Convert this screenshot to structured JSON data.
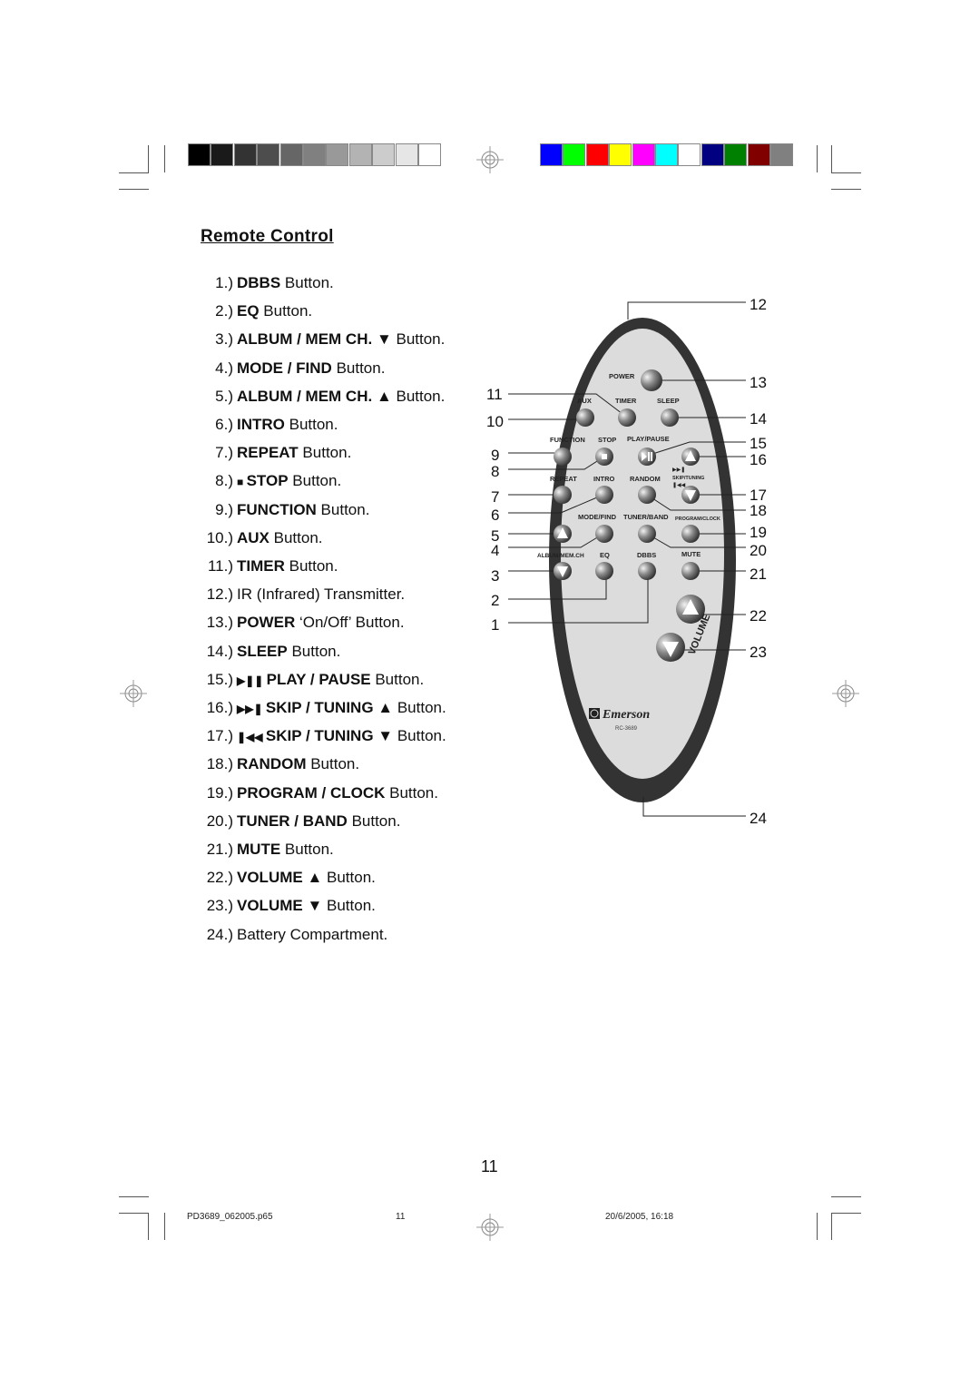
{
  "print_marks": {
    "grayscale_bar": [
      "#000000",
      "#1a1a1a",
      "#333333",
      "#4d4d4d",
      "#666666",
      "#808080",
      "#999999",
      "#b3b3b3",
      "#cccccc",
      "#e6e6e6",
      "#ffffff"
    ],
    "color_bar": [
      "#0000ff",
      "#00ff00",
      "#ff0000",
      "#ffff00",
      "#ff00ff",
      "#00ffff",
      "#ffffff",
      "#000080",
      "#008000",
      "#800000",
      "#808080"
    ]
  },
  "section_title": "Remote Control",
  "items": [
    {
      "n": "1.)",
      "icon": "",
      "bold": "DBBS",
      "rest": " Button."
    },
    {
      "n": "2.)",
      "icon": "",
      "bold": "EQ",
      "rest": " Button."
    },
    {
      "n": "3.)",
      "icon": "",
      "bold": "ALBUM / MEM CH.",
      "rest": " ▼ Button."
    },
    {
      "n": "4.)",
      "icon": "",
      "bold": "MODE / FIND",
      "rest": " Button."
    },
    {
      "n": "5.)",
      "icon": "",
      "bold": "ALBUM / MEM CH.",
      "rest": " ▲ Button."
    },
    {
      "n": "6.)",
      "icon": "",
      "bold": "INTRO",
      "rest": " Button."
    },
    {
      "n": "7.)",
      "icon": "",
      "bold": "REPEAT",
      "rest": " Button."
    },
    {
      "n": "8.)",
      "icon": "■ ",
      "bold": "STOP",
      "rest": " Button."
    },
    {
      "n": "9.)",
      "icon": "",
      "bold": "FUNCTION",
      "rest": " Button."
    },
    {
      "n": "10.)",
      "icon": "",
      "bold": "AUX",
      "rest": " Button."
    },
    {
      "n": "11.)",
      "icon": "",
      "bold": "TIMER",
      "rest": " Button."
    },
    {
      "n": "12.)",
      "icon": "",
      "bold": "",
      "rest": "IR (Infrared) Transmitter."
    },
    {
      "n": "13.)",
      "icon": "",
      "bold": "POWER",
      "rest": " ‘On/Off’ Button."
    },
    {
      "n": "14.)",
      "icon": "",
      "bold": "SLEEP",
      "rest": " Button."
    },
    {
      "n": "15.)",
      "icon": "▶❚❚ ",
      "bold": "PLAY / PAUSE",
      "rest": " Button."
    },
    {
      "n": "16.)",
      "icon": "▶▶❚ ",
      "bold": "SKIP / TUNING",
      "rest": " ▲ Button."
    },
    {
      "n": "17.)",
      "icon": "❚◀◀ ",
      "bold": "SKIP / TUNING",
      "rest": " ▼ Button."
    },
    {
      "n": "18.)",
      "icon": "",
      "bold": "RANDOM",
      "rest": " Button."
    },
    {
      "n": "19.)",
      "icon": "",
      "bold": "PROGRAM / CLOCK",
      "rest": " Button."
    },
    {
      "n": "20.)",
      "icon": "",
      "bold": "TUNER / BAND",
      "rest": " Button."
    },
    {
      "n": "21.)",
      "icon": "",
      "bold": "MUTE",
      "rest": " Button."
    },
    {
      "n": "22.)",
      "icon": "",
      "bold": "VOLUME",
      "rest": " ▲ Button."
    },
    {
      "n": "23.)",
      "icon": "",
      "bold": "VOLUME",
      "rest": " ▼ Button."
    },
    {
      "n": "24.)",
      "icon": "",
      "bold": "",
      "rest": "Battery Compartment."
    }
  ],
  "remote": {
    "labels": {
      "power": "POWER",
      "aux": "AUX",
      "timer": "TIMER",
      "sleep": "SLEEP",
      "function": "FUNCTION",
      "stop": "STOP",
      "play_pause": "PLAY/PAUSE",
      "repeat": "REPEAT",
      "intro": "INTRO",
      "random": "RANDOM",
      "skip_tuning": "SKIP/TUNING",
      "mode_find": "MODE/FIND",
      "tuner_band": "TUNER/BAND",
      "program_clock": "PROGRAM/CLOCK",
      "album_mem": "ALBUM/MEM.CH",
      "eq": "EQ",
      "dbbs": "DBBS",
      "mute": "MUTE",
      "volume": "VOLUME"
    },
    "brand": "Emerson",
    "model": "RC-3689",
    "callouts_left": [
      "11",
      "10",
      "9",
      "8",
      "7",
      "6",
      "5",
      "4",
      "3",
      "2",
      "1"
    ],
    "callouts_right": [
      "12",
      "13",
      "14",
      "15",
      "16",
      "17",
      "18",
      "19",
      "20",
      "21",
      "22",
      "23",
      "24"
    ]
  },
  "page_number": "11",
  "footer": {
    "file": "PD3689_062005.p65",
    "page": "11",
    "datetime": "20/6/2005, 16:18"
  }
}
